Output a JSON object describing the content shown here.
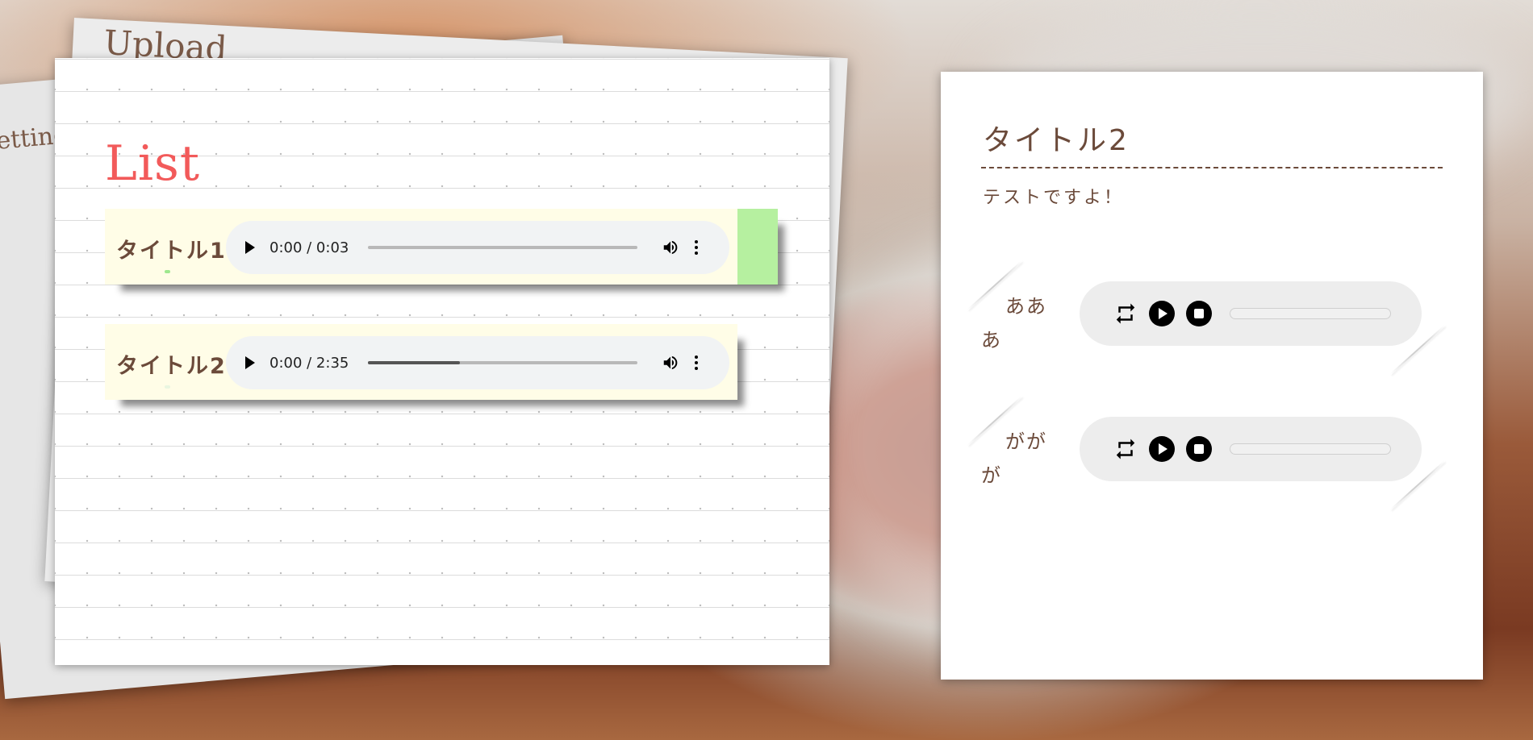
{
  "background_papers": {
    "upload_title": "Upload",
    "setting_title": "etting"
  },
  "list": {
    "heading": "List",
    "tracks": [
      {
        "title": "タイトル1",
        "time": "0:00 / 0:03",
        "progress": 0.0
      },
      {
        "title": "タイトル2",
        "time": "0:00 / 2:35",
        "progress": 0.34
      }
    ]
  },
  "detail": {
    "title": "タイトル2",
    "description": "テストですよ！",
    "sounds": [
      {
        "label": "あああ"
      },
      {
        "label": "ががが"
      }
    ]
  },
  "colors": {
    "heading_red": "#f25a5a",
    "text_brown": "#6b4a3a",
    "row_yellow": "#fffde7",
    "selected_green": "#b6f0a0"
  }
}
